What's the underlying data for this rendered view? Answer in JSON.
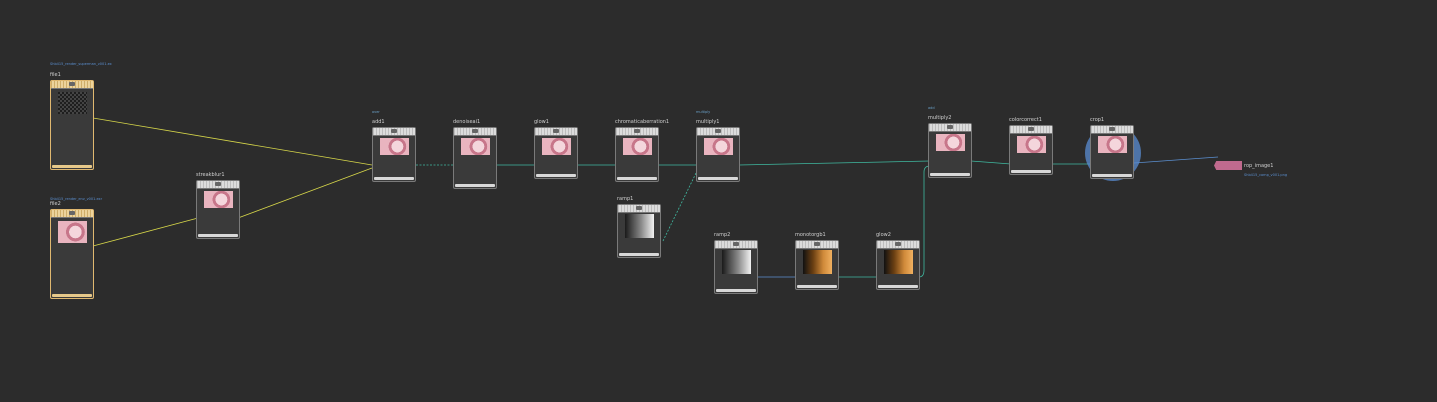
{
  "nodes": {
    "file1": {
      "name": "file1",
      "path": "Shb415_render_superman_v001.ex"
    },
    "file2": {
      "name": "file2",
      "path": "Shb415_render_env_v001.exr"
    },
    "streakblur1": {
      "name": "streakblur1"
    },
    "add1": {
      "name": "add1",
      "meta": "over"
    },
    "denoiseai1": {
      "name": "denoiseai1"
    },
    "glow1": {
      "name": "glow1"
    },
    "chromaticaberration1": {
      "name": "chromaticaberration1"
    },
    "multiply1": {
      "name": "multiply1",
      "meta": "multiply"
    },
    "ramp1": {
      "name": "ramp1"
    },
    "ramp2": {
      "name": "ramp2"
    },
    "monotorgb1": {
      "name": "monotorgb1"
    },
    "glow2": {
      "name": "glow2"
    },
    "multiply2": {
      "name": "multiply2",
      "meta": "add"
    },
    "colorcorrect1": {
      "name": "colorcorrect1"
    },
    "crop1": {
      "name": "crop1"
    },
    "rop_image1": {
      "name": "rop_image1",
      "path": "Shb415_comp_v001.png"
    }
  },
  "colors": {
    "background": "#2c2c2c",
    "wire_yellow": "#d8d84a",
    "wire_teal": "#3fb9a0",
    "wire_blue": "#5b8fd0",
    "selection": "#5a8cd2",
    "rop": "#c06a8e"
  }
}
